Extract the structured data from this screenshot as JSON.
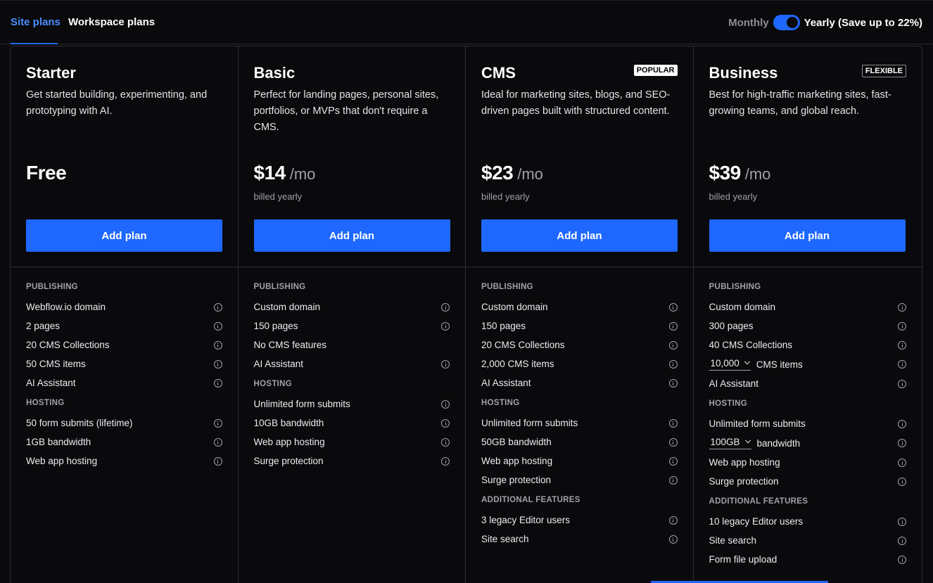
{
  "tabs": {
    "site": "Site plans",
    "workspace": "Workspace plans"
  },
  "billing": {
    "monthly": "Monthly",
    "yearly": "Yearly (Save up to 22%)",
    "yearly_selected": true
  },
  "colors": {
    "accent": "#1f68ff",
    "background": "#0a0a0c",
    "border": "#2e2e33"
  },
  "plans": [
    {
      "name": "Starter",
      "badge": "",
      "description": "Get started building, experimenting, and prototyping with AI.",
      "price": "Free",
      "period": "",
      "billed": "",
      "cta": "Add plan",
      "sections": [
        {
          "title": "PUBLISHING",
          "items": [
            {
              "label": "Webflow.io domain"
            },
            {
              "label": "2 pages"
            },
            {
              "label": "20 CMS Collections"
            },
            {
              "label": "50 CMS items"
            },
            {
              "label": "AI Assistant"
            }
          ]
        },
        {
          "title": "HOSTING",
          "items": [
            {
              "label": "50 form submits (lifetime)"
            },
            {
              "label": "1GB bandwidth"
            },
            {
              "label": "Web app hosting"
            }
          ]
        }
      ]
    },
    {
      "name": "Basic",
      "badge": "",
      "description": "Perfect for landing pages, personal sites, portfolios, or MVPs that don't require a CMS.",
      "price": "$14",
      "period": "/mo",
      "billed": "billed yearly",
      "cta": "Add plan",
      "sections": [
        {
          "title": "PUBLISHING",
          "items": [
            {
              "label": "Custom domain"
            },
            {
              "label": "150 pages"
            },
            {
              "label": "No CMS features"
            },
            {
              "label": "AI Assistant"
            }
          ]
        },
        {
          "title": "HOSTING",
          "items": [
            {
              "label": "Unlimited form submits"
            },
            {
              "label": "10GB bandwidth"
            },
            {
              "label": "Web app hosting"
            },
            {
              "label": "Surge protection"
            }
          ]
        }
      ]
    },
    {
      "name": "CMS",
      "badge": "POPULAR",
      "description": "Ideal for marketing sites, blogs, and SEO-driven pages built with structured content.",
      "price": "$23",
      "period": "/mo",
      "billed": "billed yearly",
      "cta": "Add plan",
      "sections": [
        {
          "title": "PUBLISHING",
          "items": [
            {
              "label": "Custom domain"
            },
            {
              "label": "150 pages"
            },
            {
              "label": "20 CMS Collections"
            },
            {
              "label": "2,000 CMS items"
            },
            {
              "label": "AI Assistant"
            }
          ]
        },
        {
          "title": "HOSTING",
          "items": [
            {
              "label": "Unlimited form submits"
            },
            {
              "label": "50GB bandwidth"
            },
            {
              "label": "Web app hosting"
            },
            {
              "label": "Surge protection"
            }
          ]
        },
        {
          "title": "ADDITIONAL FEATURES",
          "items": [
            {
              "label": "3 legacy Editor users"
            },
            {
              "label": "Site search"
            }
          ]
        }
      ]
    },
    {
      "name": "Business",
      "badge": "FLEXIBLE",
      "description": "Best for high-traffic marketing sites, fast-growing teams, and global reach.",
      "price": "$39",
      "period": "/mo",
      "billed": "billed yearly",
      "cta": "Add plan",
      "sections": [
        {
          "title": "PUBLISHING",
          "items": [
            {
              "label": "Custom domain"
            },
            {
              "label": "300 pages"
            },
            {
              "label": "40 CMS Collections"
            },
            {
              "select": "10,000",
              "label": "CMS items"
            },
            {
              "label": "AI Assistant"
            }
          ]
        },
        {
          "title": "HOSTING",
          "items": [
            {
              "label": "Unlimited form submits"
            },
            {
              "select": "100GB",
              "label": "bandwidth"
            },
            {
              "label": "Web app hosting"
            },
            {
              "label": "Surge protection"
            }
          ]
        },
        {
          "title": "ADDITIONAL FEATURES",
          "items": [
            {
              "label": "10 legacy Editor users"
            },
            {
              "label": "Site search"
            },
            {
              "label": "Form file upload"
            }
          ]
        }
      ]
    }
  ]
}
